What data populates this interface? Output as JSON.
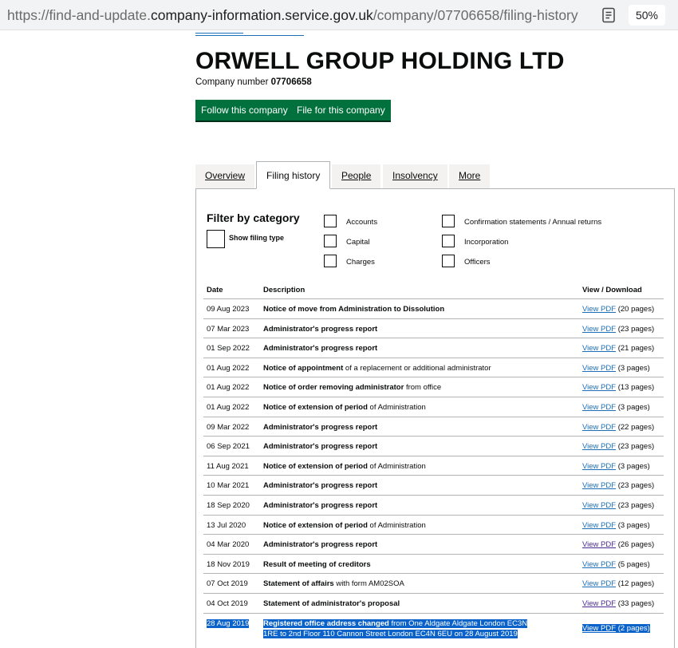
{
  "browser": {
    "url_prefix": "https://find-and-update.",
    "url_host": "company-information.service.gov.uk",
    "url_path": "/company/07706658/filing-history",
    "zoom": "50%"
  },
  "company": {
    "name": "ORWELL GROUP HOLDING LTD",
    "number_label": "Company number",
    "number": "07706658"
  },
  "actions": {
    "follow": "Follow this company",
    "file": "File for this company"
  },
  "tabs": [
    {
      "label": "Overview"
    },
    {
      "label": "Filing history"
    },
    {
      "label": "People"
    },
    {
      "label": "Insolvency"
    },
    {
      "label": "More"
    }
  ],
  "filter": {
    "title": "Filter by category",
    "show_filing_type": "Show filing type",
    "categories": [
      "Accounts",
      "Capital",
      "Charges",
      "Confirmation statements / Annual returns",
      "Incorporation",
      "Officers"
    ]
  },
  "table": {
    "headers": {
      "date": "Date",
      "description": "Description",
      "view": "View / Download"
    },
    "link_text": "View PDF",
    "rows": [
      {
        "date": "09 Aug 2023",
        "bold": "Notice of move from Administration to Dissolution",
        "rest": "",
        "pages": "(20 pages)"
      },
      {
        "date": "07 Mar 2023",
        "bold": "Administrator's progress report",
        "rest": "",
        "pages": "(23 pages)"
      },
      {
        "date": "01 Sep 2022",
        "bold": "Administrator's progress report",
        "rest": "",
        "pages": "(21 pages)"
      },
      {
        "date": "01 Aug 2022",
        "bold": "Notice of appointment",
        "rest": " of a replacement or additional administrator",
        "pages": "(3 pages)"
      },
      {
        "date": "01 Aug 2022",
        "bold": "Notice of order removing administrator",
        "rest": " from office",
        "pages": "(13 pages)"
      },
      {
        "date": "01 Aug 2022",
        "bold": "Notice of extension of period",
        "rest": " of Administration",
        "pages": "(3 pages)"
      },
      {
        "date": "09 Mar 2022",
        "bold": "Administrator's progress report",
        "rest": "",
        "pages": "(22 pages)"
      },
      {
        "date": "06 Sep 2021",
        "bold": "Administrator's progress report",
        "rest": "",
        "pages": "(23 pages)"
      },
      {
        "date": "11 Aug 2021",
        "bold": "Notice of extension of period",
        "rest": " of Administration",
        "pages": "(3 pages)"
      },
      {
        "date": "10 Mar 2021",
        "bold": "Administrator's progress report",
        "rest": "",
        "pages": "(23 pages)"
      },
      {
        "date": "18 Sep 2020",
        "bold": "Administrator's progress report",
        "rest": "",
        "pages": "(23 pages)"
      },
      {
        "date": "13 Jul 2020",
        "bold": "Notice of extension of period",
        "rest": " of Administration",
        "pages": "(3 pages)"
      },
      {
        "date": "04 Mar 2020",
        "bold": "Administrator's progress report",
        "rest": "",
        "pages": "(26 pages)"
      },
      {
        "date": "18 Nov 2019",
        "bold": "Result of meeting of creditors",
        "rest": "",
        "pages": "(5 pages)"
      },
      {
        "date": "07 Oct 2019",
        "bold": "Statement of affairs",
        "rest": " with form AM02SOA",
        "pages": "(12 pages)"
      },
      {
        "date": "04 Oct 2019",
        "bold": "Statement of administrator's proposal",
        "rest": "",
        "pages": "(33 pages)"
      }
    ],
    "last_row": {
      "date": "28 Aug 2019",
      "bold": "Registered office address changed",
      "rest_line1": " from One Aldgate Aldgate London EC3N",
      "line2": "1RE to 2nd Floor 110 Cannon Street London EC4N 6EU on 28 August 2019",
      "pages": "(2 pages)"
    }
  }
}
